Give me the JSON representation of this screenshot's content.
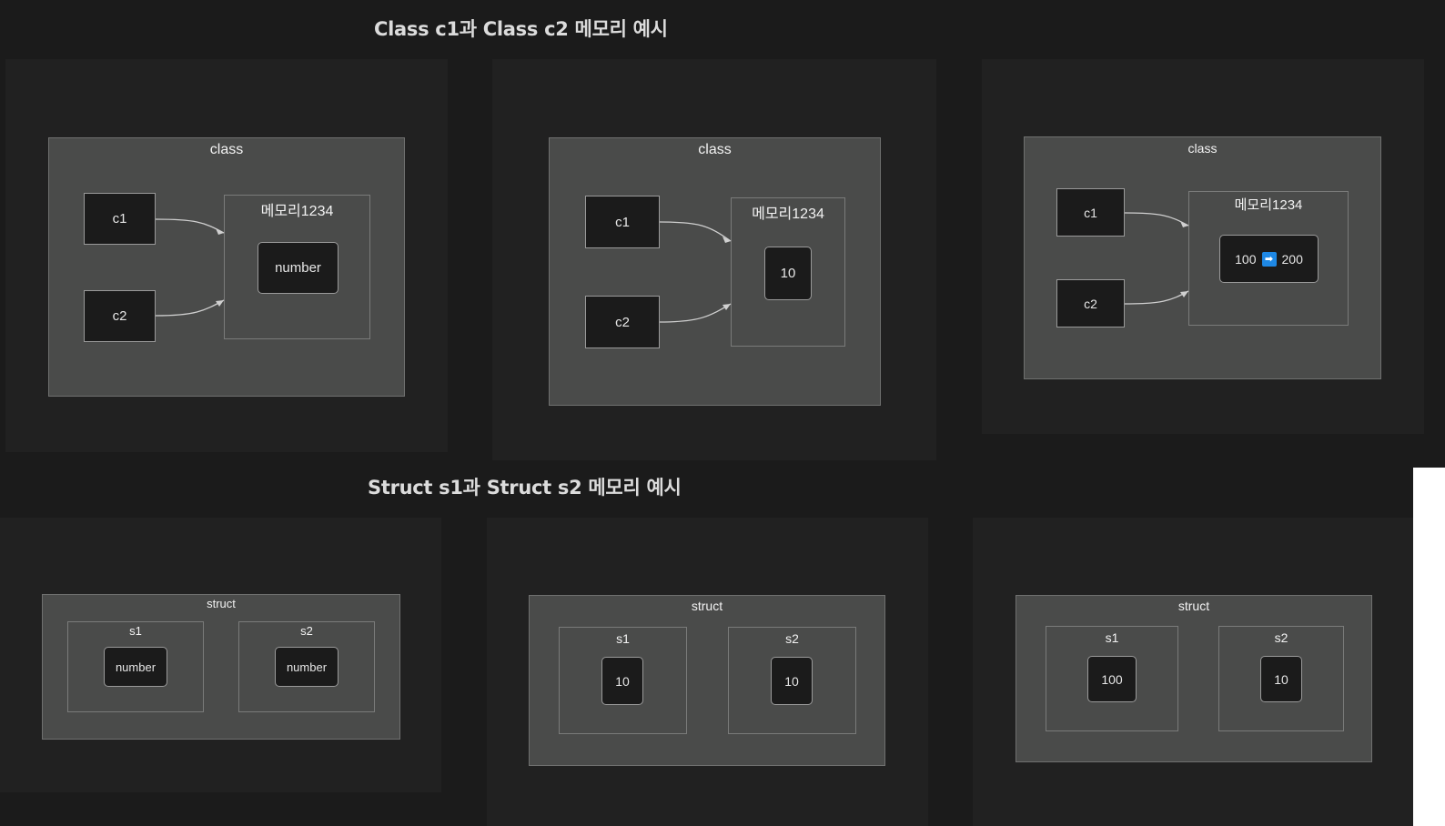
{
  "titles": {
    "class_title": "Class c1과 Class c2 메모리 예시",
    "struct_title": "Struct s1과 Struct s2 메모리 예시"
  },
  "class_diagrams": [
    {
      "group": "class",
      "ref1": "c1",
      "ref2": "c2",
      "memory": "메모리1234",
      "value": "number"
    },
    {
      "group": "class",
      "ref1": "c1",
      "ref2": "c2",
      "memory": "메모리1234",
      "value": "10"
    },
    {
      "group": "class",
      "ref1": "c1",
      "ref2": "c2",
      "memory": "메모리1234",
      "value_before": "100",
      "arrow_icon": "➡",
      "value_after": "200"
    }
  ],
  "struct_diagrams": [
    {
      "group": "struct",
      "s1_label": "s1",
      "s1_value": "number",
      "s2_label": "s2",
      "s2_value": "number"
    },
    {
      "group": "struct",
      "s1_label": "s1",
      "s1_value": "10",
      "s2_label": "s2",
      "s2_value": "10"
    },
    {
      "group": "struct",
      "s1_label": "s1",
      "s1_value": "100",
      "s2_label": "s2",
      "s2_value": "10"
    }
  ],
  "colors": {
    "background": "#1b1b1b",
    "panel": "#212121",
    "group_fill": "#4a4b4a",
    "node_fill": "#1b1b1b",
    "edge": "#d0d0d0",
    "arrow_emoji": "#1e88e5"
  }
}
